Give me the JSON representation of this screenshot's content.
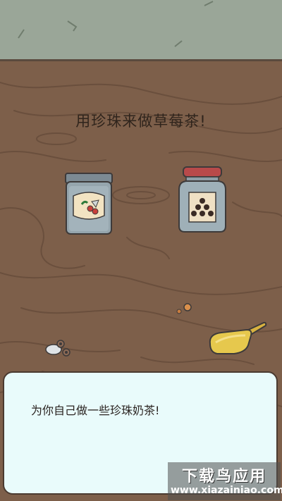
{
  "instruction": {
    "text": "用珍珠来做草莓茶!"
  },
  "dialog": {
    "text": "为你自己做一些珍珠奶茶!"
  },
  "items": {
    "strawberry_jar": {
      "icon": "strawberry-jar-icon"
    },
    "pearl_jar": {
      "icon": "pearl-jar-icon"
    },
    "scoop": {
      "icon": "scoop-icon"
    },
    "pebbles": {
      "icon": "pebbles-icon"
    },
    "crumbs": {
      "icon": "shell-crumbs-icon"
    }
  },
  "watermark": {
    "brand": "下载鸟应用",
    "url": "www.xiazainiao.com"
  },
  "colors": {
    "wall": "#9aa698",
    "wood": "#7d5f4a",
    "wood_grain": "#6e5240",
    "dialog_bg": "#e9fbfb",
    "jar_lid": "#b84a4a"
  }
}
